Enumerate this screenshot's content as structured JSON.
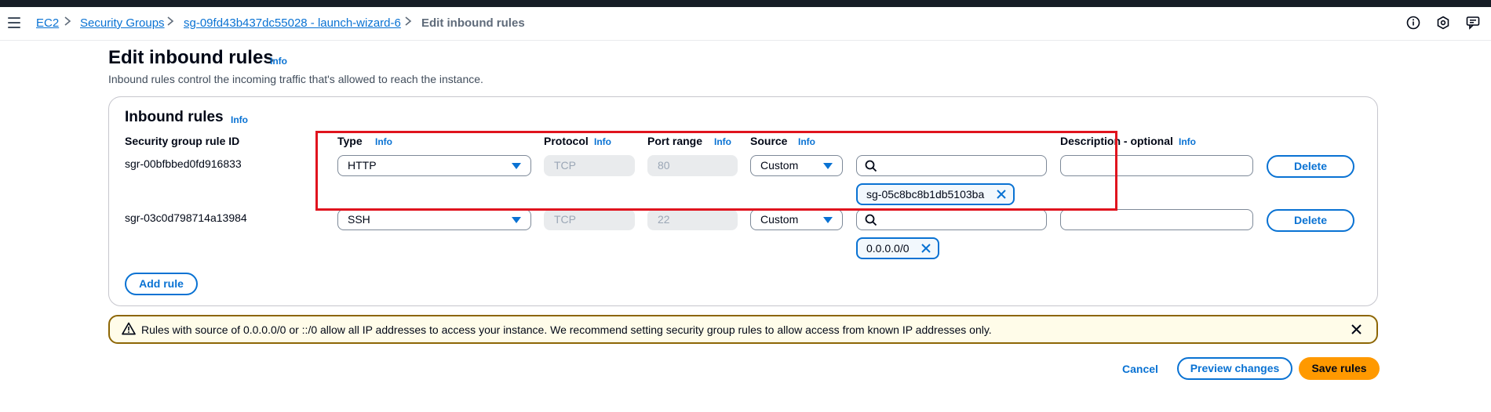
{
  "breadcrumbs": {
    "items": [
      {
        "label": "EC2"
      },
      {
        "label": "Security Groups"
      },
      {
        "label": "sg-09fd43b437dc55028 - launch-wizard-6"
      }
    ],
    "current": "Edit inbound rules"
  },
  "header_icons": [
    "info-circle-icon",
    "settings-hex-icon",
    "feedback-icon"
  ],
  "page": {
    "title": "Edit inbound rules",
    "info": "Info",
    "description": "Inbound rules control the incoming traffic that's allowed to reach the instance."
  },
  "panel": {
    "title": "Inbound rules",
    "info": "Info",
    "columns": {
      "rule_id": "Security group rule ID",
      "type": "Type",
      "protocol": "Protocol",
      "port_range": "Port range",
      "source": "Source",
      "description": "Description - optional"
    },
    "col_info": "Info",
    "rules": [
      {
        "id": "sgr-00bfbbed0fd916833",
        "type": "HTTP",
        "protocol": "TCP",
        "port_range": "80",
        "source": "Custom",
        "search_value": "",
        "token": "sg-05c8bc8b1db5103ba",
        "description": "",
        "delete_label": "Delete"
      },
      {
        "id": "sgr-03c0d798714a13984",
        "type": "SSH",
        "protocol": "TCP",
        "port_range": "22",
        "source": "Custom",
        "search_value": "",
        "token": "0.0.0.0/0",
        "description": "",
        "delete_label": "Delete"
      }
    ],
    "add_rule_label": "Add rule"
  },
  "alert": {
    "text": "Rules with source of 0.0.0.0/0 or ::/0 allow all IP addresses to access your instance. We recommend setting security group rules to allow access from known IP addresses only."
  },
  "footer": {
    "cancel_label": "Cancel",
    "preview_label": "Preview changes",
    "save_label": "Save rules"
  },
  "colors": {
    "link": "#0972d3",
    "primary": "#ff9900",
    "warning_border": "#8d6605",
    "warning_bg": "#fffce9",
    "highlight": "#e0141e"
  }
}
